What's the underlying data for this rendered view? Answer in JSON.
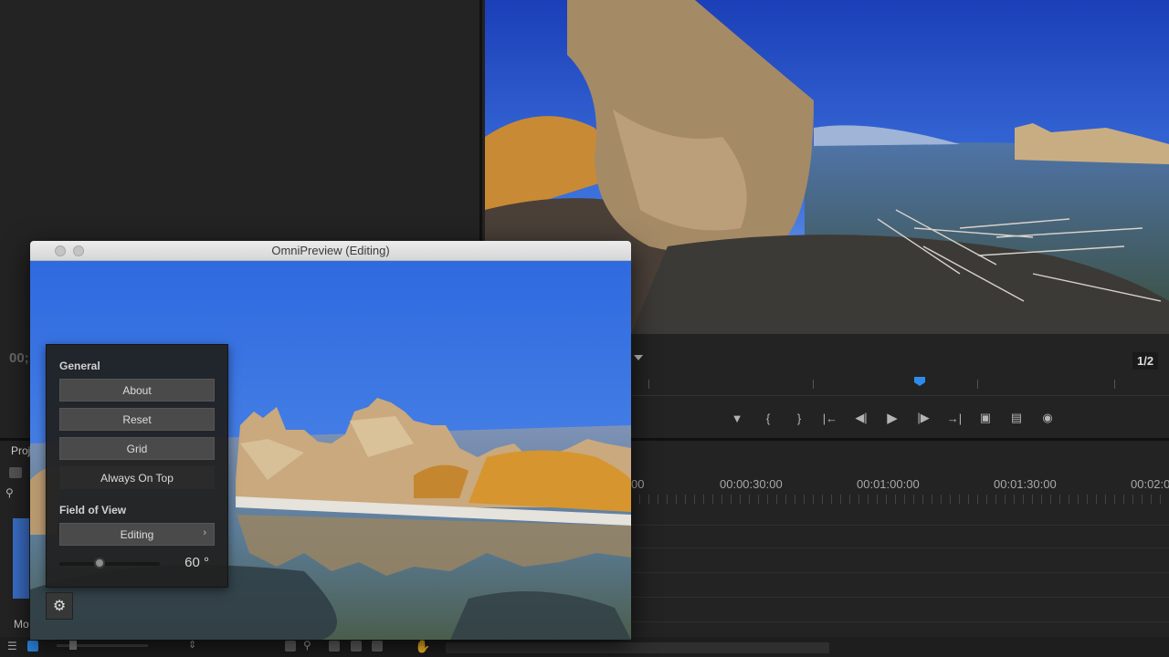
{
  "window": {
    "title": "OmniPreview (Editing)"
  },
  "settings_panel": {
    "general_label": "General",
    "about_label": "About",
    "reset_label": "Reset",
    "grid_label": "Grid",
    "always_on_top_label": "Always On Top",
    "fov_label": "Field of View",
    "fov_mode": "Editing",
    "fov_mode_chevron": "›",
    "fov_value": "60 °",
    "fov_level": 0.4
  },
  "program_monitor": {
    "fraction": "1/2",
    "left_timecode": "00;"
  },
  "transport": {
    "icons": [
      "marker-icon",
      "mark-in-icon",
      "mark-out-icon",
      "go-to-in-icon",
      "step-back-icon",
      "play-icon",
      "step-forward-icon",
      "go-to-out-icon",
      "insert-icon",
      "overwrite-icon",
      "export-frame-icon"
    ]
  },
  "timeline": {
    "times": [
      "00",
      "00:00:30:00",
      "00:01:00:00",
      "00:01:30:00",
      "00:02:0"
    ]
  },
  "project": {
    "tab_label": "Proj",
    "item_label": "Mo"
  },
  "colors": {
    "accent": "#2d8ceb",
    "sky": "#3d78e0"
  }
}
